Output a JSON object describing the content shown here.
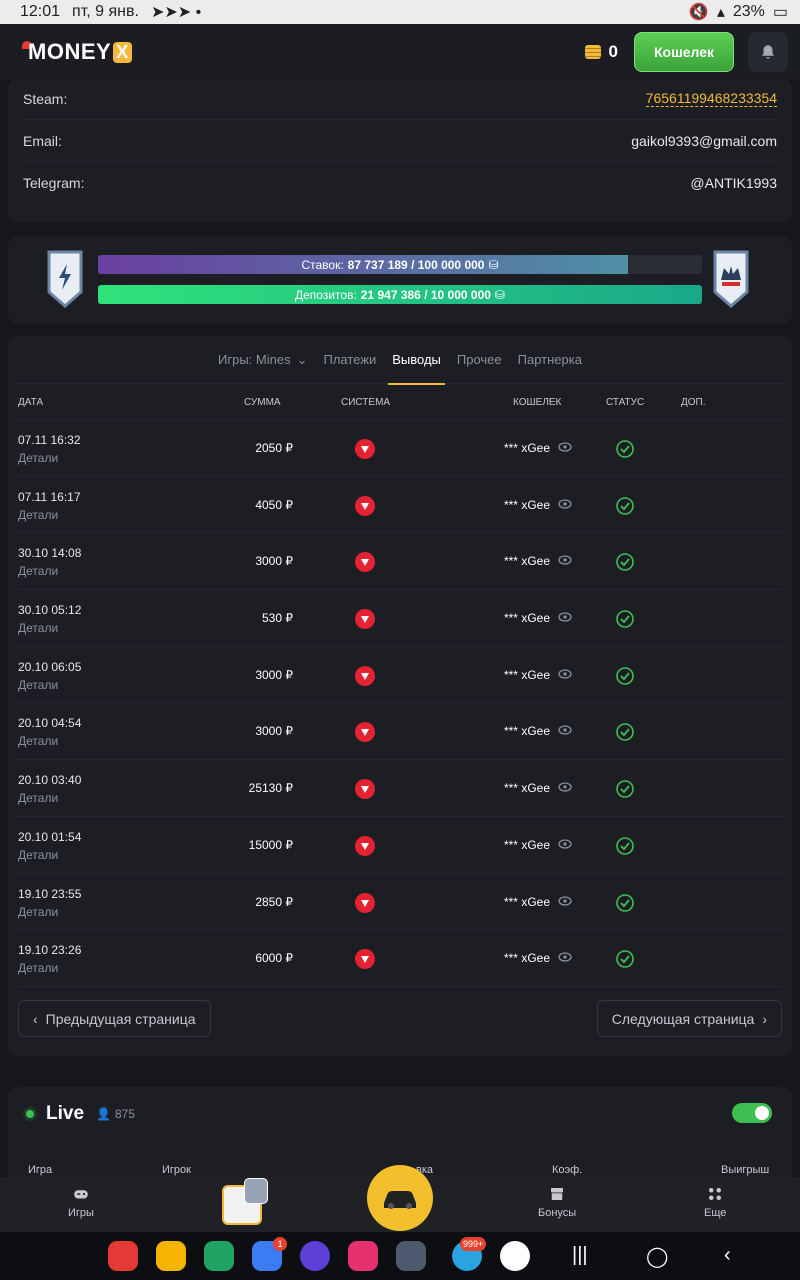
{
  "status_bar": {
    "time": "12:01",
    "date": "пт, 9 янв.",
    "battery": "23%"
  },
  "header": {
    "logo_text": "MONEY",
    "logo_x": "X",
    "balance": "0",
    "wallet_label": "Кошелек"
  },
  "profile": {
    "rows": [
      {
        "label": "Steam:",
        "value": "76561199468233354"
      },
      {
        "label": "Email:",
        "value": "gaikol9393@gmail.com"
      },
      {
        "label": "Telegram:",
        "value": "@ANTIK1993"
      }
    ]
  },
  "progress": {
    "bets_label": "Ставок:",
    "bets_value": "87 737 189 / 100 000 000",
    "bets_fraction": 0.877,
    "deposits_label": "Депозитов:",
    "deposits_value": "21 947 386 / 10 000 000",
    "deposits_fraction": 1.0
  },
  "tabs": [
    "Игры: Mines",
    "Платежи",
    "Выводы",
    "Прочее",
    "Партнерка"
  ],
  "active_tab": "Выводы",
  "table": {
    "columns": [
      "ДАТА",
      "СУММА",
      "СИСТЕМА",
      "КОШЕЛЕК",
      "СТАТУС",
      "ДОП."
    ],
    "details_label": "Детали",
    "rows": [
      {
        "date": "07.11 16:32",
        "sum": "2050 ₽",
        "wallet": "*** xGee"
      },
      {
        "date": "07.11 16:17",
        "sum": "4050 ₽",
        "wallet": "*** xGee"
      },
      {
        "date": "30.10 14:08",
        "sum": "3000 ₽",
        "wallet": "*** xGee"
      },
      {
        "date": "30.10 05:12",
        "sum": "530 ₽",
        "wallet": "*** xGee"
      },
      {
        "date": "20.10 06:05",
        "sum": "3000 ₽",
        "wallet": "*** xGee"
      },
      {
        "date": "20.10 04:54",
        "sum": "3000 ₽",
        "wallet": "*** xGee"
      },
      {
        "date": "20.10 03:40",
        "sum": "25130 ₽",
        "wallet": "*** xGee"
      },
      {
        "date": "20.10 01:54",
        "sum": "15000 ₽",
        "wallet": "*** xGee"
      },
      {
        "date": "19.10 23:55",
        "sum": "2850 ₽",
        "wallet": "*** xGee"
      },
      {
        "date": "19.10 23:26",
        "sum": "6000 ₽",
        "wallet": "*** xGee"
      }
    ]
  },
  "pager": {
    "prev": "Предыдущая страница",
    "next": "Следующая страница"
  },
  "live": {
    "title": "Live",
    "online": "875",
    "columns": [
      "Игра",
      "Игрок",
      "вка",
      "Коэф.",
      "Выигрыш"
    ]
  },
  "bottom_nav": {
    "games": "Игры",
    "bonuses": "Бонусы",
    "more": "Еще"
  },
  "dock": {
    "telegram_badge": "999+",
    "messages_badge": "1"
  },
  "colors": {
    "accent": "#f2b93b",
    "green": "#3fbf52",
    "bg": "#15171c",
    "card": "#1c1e24"
  }
}
